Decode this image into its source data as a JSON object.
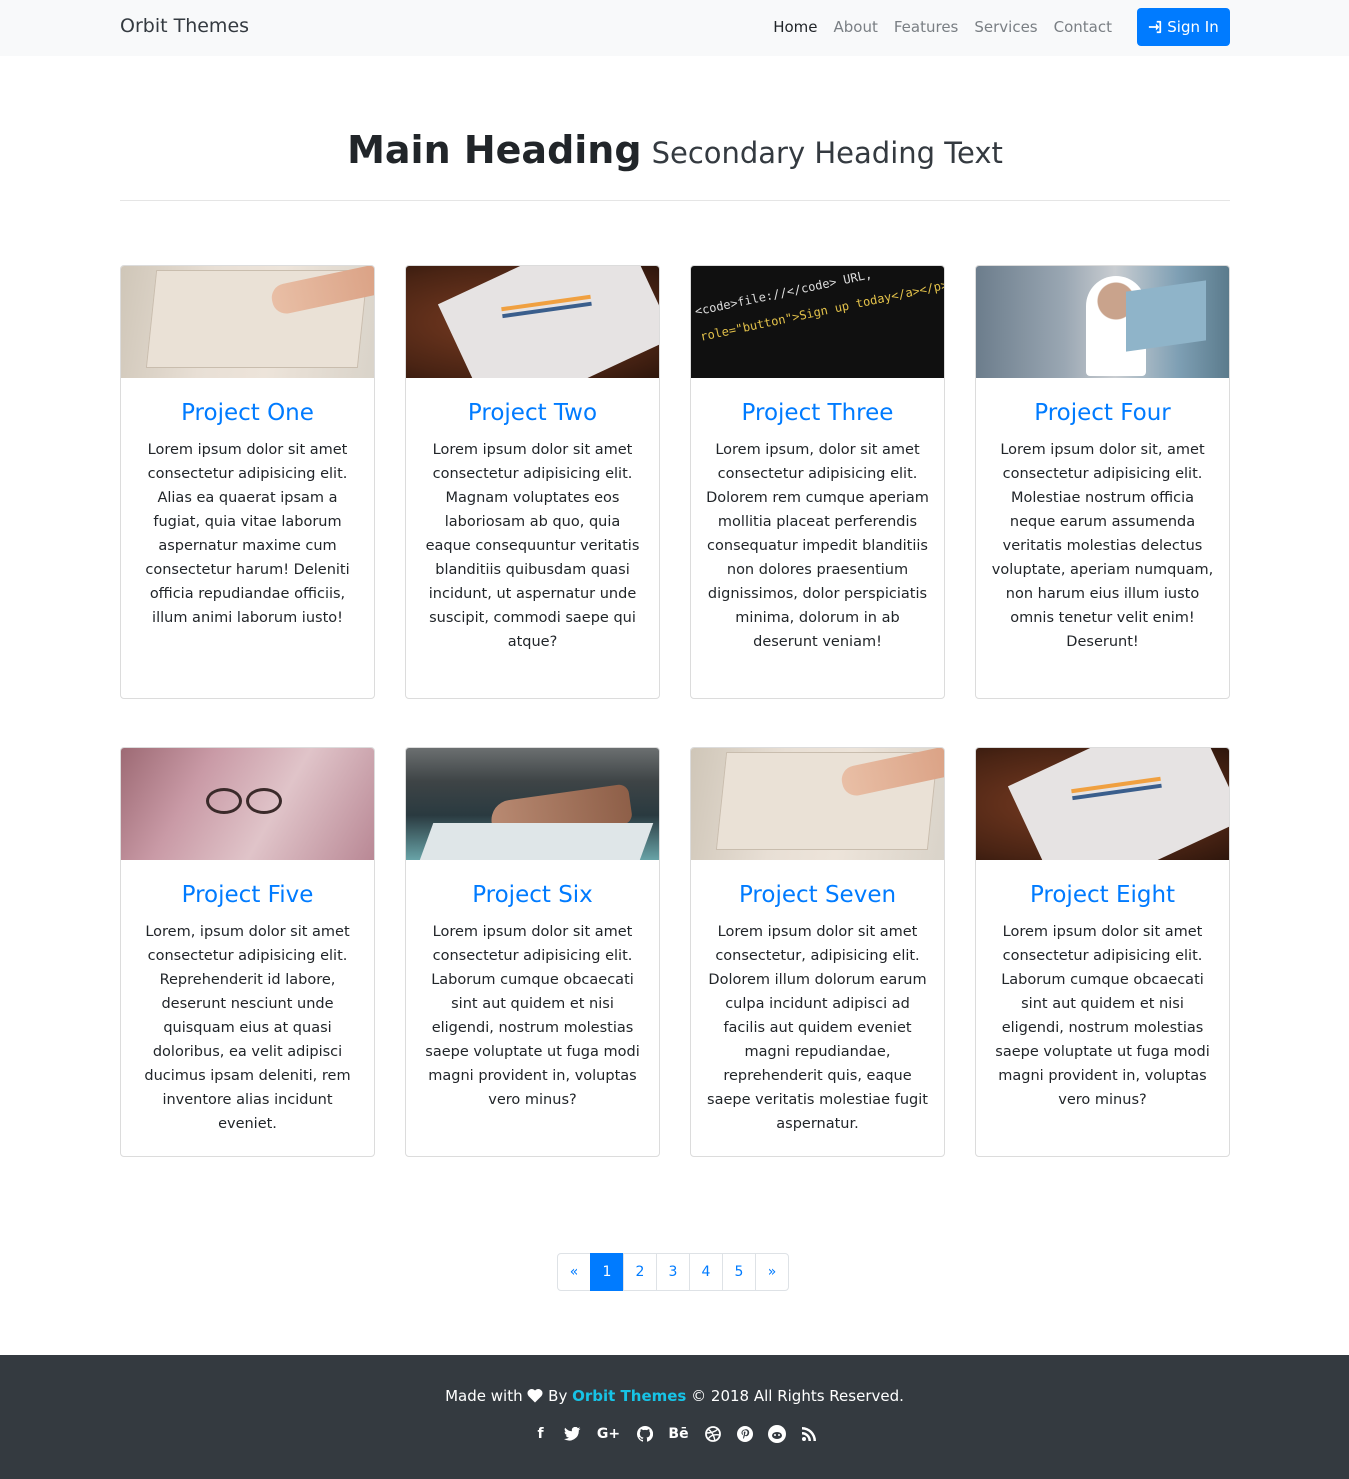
{
  "navbar": {
    "brand": "Orbit Themes",
    "links": [
      {
        "label": "Home",
        "active": true
      },
      {
        "label": "About",
        "active": false
      },
      {
        "label": "Features",
        "active": false
      },
      {
        "label": "Services",
        "active": false
      },
      {
        "label": "Contact",
        "active": false
      }
    ],
    "signin_label": "Sign In",
    "signin_icon": "sign-in-icon"
  },
  "heading": {
    "main": "Main Heading",
    "secondary": "Secondary Heading Text"
  },
  "projects": [
    {
      "title": "Project One",
      "text": "Lorem ipsum dolor sit amet consectetur adipisicing elit. Alias ea quaerat ipsam a fugiat, quia vitae laborum aspernatur maxime cum consectetur harum! Deleniti officia repudiandae officiis, illum animi laborum iusto!",
      "image": "notebook"
    },
    {
      "title": "Project Two",
      "text": "Lorem ipsum dolor sit amet consectetur adipisicing elit. Magnam voluptates eos laboriosam ab quo, quia eaque consequuntur veritatis blanditiis quibusdam quasi incidunt, ut aspernatur unde suscipit, commodi saepe qui atque?",
      "image": "paper"
    },
    {
      "title": "Project Three",
      "text": "Lorem ipsum, dolor sit amet consectetur adipisicing elit. Dolorem rem cumque aperiam mollitia placeat perferendis consequatur impedit blanditiis non dolores praesentium dignissimos, dolor perspiciatis minima, dolorum in ab deserunt veniam!",
      "image": "code"
    },
    {
      "title": "Project Four",
      "text": "Lorem ipsum dolor sit, amet consectetur adipisicing elit. Molestiae nostrum officia neque earum assumenda veritatis molestias delectus voluptate, aperiam numquam, non harum eius illum iusto omnis tenetur velit enim! Deserunt!",
      "image": "office"
    },
    {
      "title": "Project Five",
      "text": "Lorem, ipsum dolor sit amet consectetur adipisicing elit. Reprehenderit id labore, deserunt nesciunt unde quisquam eius at quasi doloribus, ea velit adipisci ducimus ipsam deleniti, rem inventore alias incidunt eveniet.",
      "image": "glasses"
    },
    {
      "title": "Project Six",
      "text": "Lorem ipsum dolor sit amet consectetur adipisicing elit. Laborum cumque obcaecati sint aut quidem et nisi eligendi, nostrum molestias saepe voluptate ut fuga modi magni provident in, voluptas vero minus?",
      "image": "hand"
    },
    {
      "title": "Project Seven",
      "text": "Lorem ipsum dolor sit amet consectetur, adipisicing elit. Dolorem illum dolorum earum culpa incidunt adipisci ad facilis aut quidem eveniet magni repudiandae, reprehenderit quis, eaque saepe veritatis molestiae fugit aspernatur.",
      "image": "notebook"
    },
    {
      "title": "Project Eight",
      "text": "Lorem ipsum dolor sit amet consectetur adipisicing elit. Laborum cumque obcaecati sint aut quidem et nisi eligendi, nostrum molestias saepe voluptate ut fuga modi magni provident in, voluptas vero minus?",
      "image": "paper"
    }
  ],
  "code_image_text": [
    "<code>file://</code> URL,",
    "role=\"button\">Sign up today</a></p>"
  ],
  "pagination": {
    "prev": "«",
    "pages": [
      "1",
      "2",
      "3",
      "4",
      "5"
    ],
    "active_page": "1",
    "next": "»"
  },
  "footer": {
    "made_with": "Made with",
    "heart_icon": "heart-icon",
    "by": "By",
    "org": "Orbit Themes",
    "copyright": "© 2018 All Rights Reserved.",
    "social_icons": [
      "facebook-icon",
      "twitter-icon",
      "google-plus-icon",
      "github-icon",
      "behance-icon",
      "dribbble-icon",
      "pinterest-icon",
      "reddit-icon",
      "rss-icon"
    ]
  },
  "colors": {
    "accent": "#007bff",
    "navbar_bg": "#f8f9fa",
    "footer_bg": "#343a40",
    "footer_link": "#17c3e6"
  }
}
